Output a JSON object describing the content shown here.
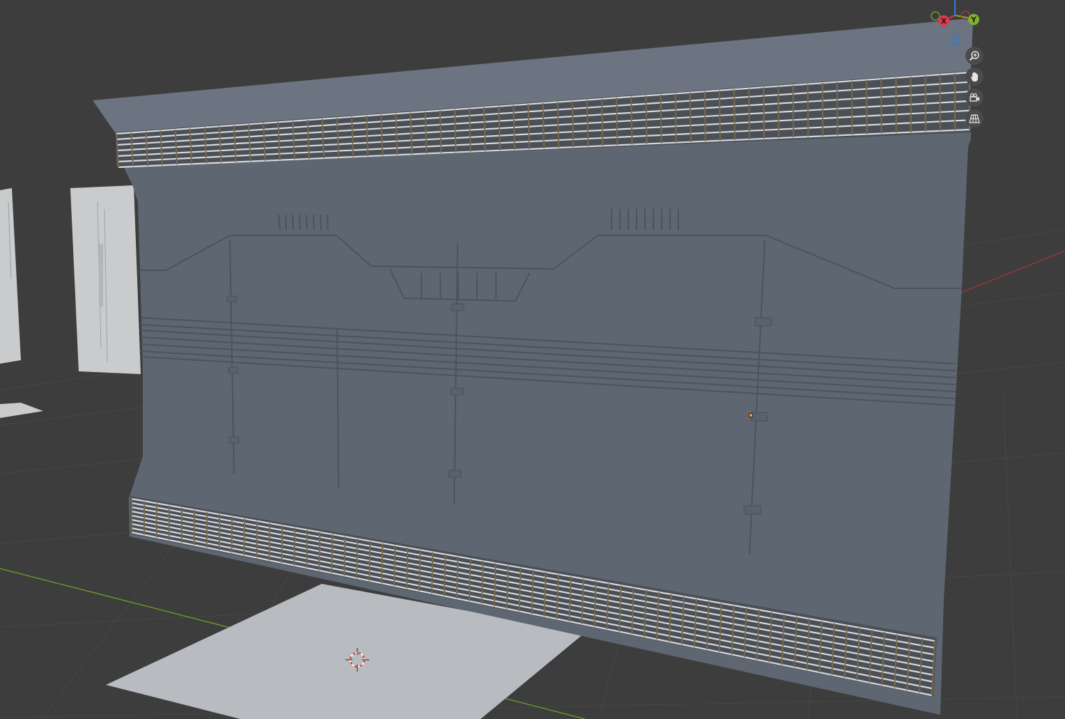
{
  "viewport": {
    "background": "#3d3d3d",
    "grid_color": "#474747",
    "x_axis_color": "#a8383c",
    "y_axis_color": "#6a9b2d",
    "wall_color": "#5e6671",
    "wall_top_color": "#6b7480",
    "floor_plane_color": "#b8bbbf",
    "side_panel_color": "#c9cbcd"
  },
  "gizmo": {
    "x_label": "X",
    "y_label": "Y",
    "x_color": "#e0394f",
    "y_color": "#7fb22a",
    "z_color": "#2f7ad6"
  },
  "navigation": [
    {
      "name": "zoom",
      "icon": "zoom-icon"
    },
    {
      "name": "pan",
      "icon": "hand-icon"
    },
    {
      "name": "camera",
      "icon": "camera-icon"
    },
    {
      "name": "perspective",
      "icon": "grid-icon"
    }
  ]
}
